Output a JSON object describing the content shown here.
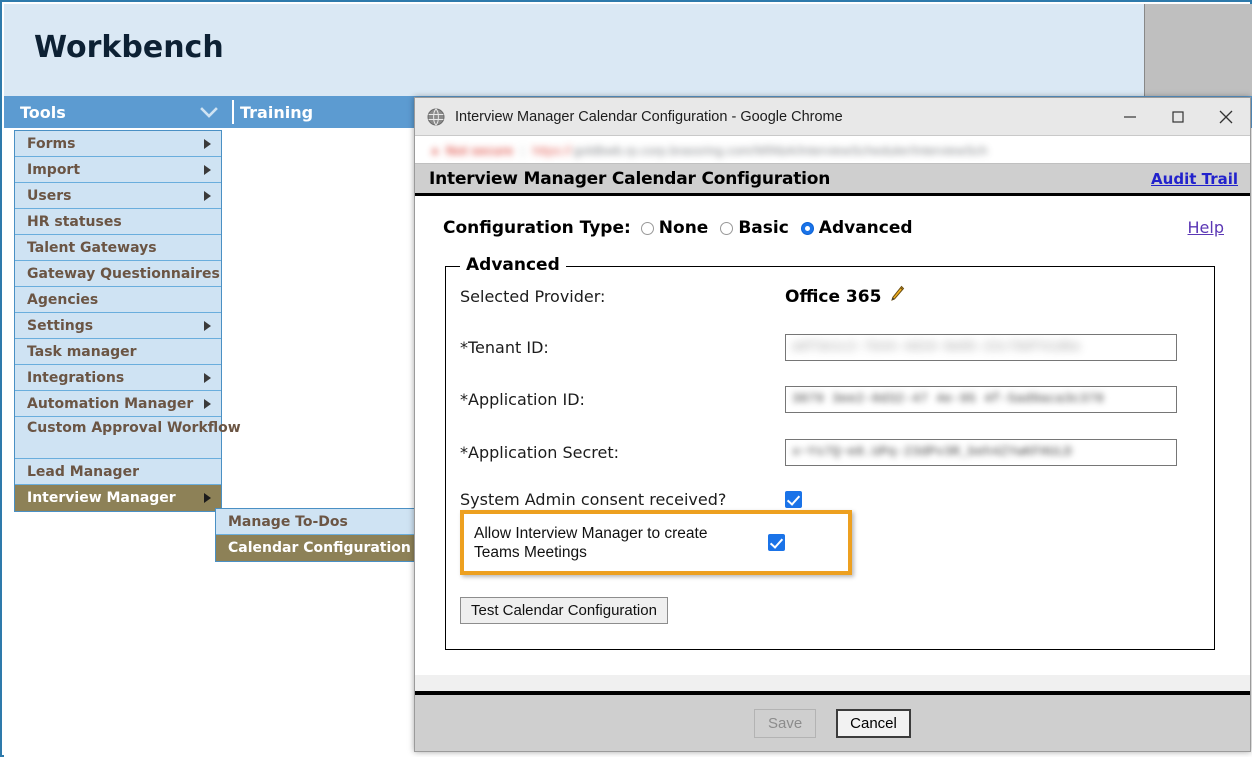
{
  "workbench": {
    "title": "Workbench",
    "menubar": {
      "tools_label": "Tools",
      "chevron_icon": "chevron-down-icon",
      "training_label": "Training"
    },
    "menu_items": [
      {
        "label": "Forms",
        "has_submenu": true
      },
      {
        "label": "Import",
        "has_submenu": true
      },
      {
        "label": "Users",
        "has_submenu": true
      },
      {
        "label": "HR statuses",
        "has_submenu": false
      },
      {
        "label": "Talent Gateways",
        "has_submenu": false
      },
      {
        "label": "Gateway Questionnaires",
        "has_submenu": false
      },
      {
        "label": "Agencies",
        "has_submenu": false
      },
      {
        "label": "Settings",
        "has_submenu": true
      },
      {
        "label": "Task manager",
        "has_submenu": false
      },
      {
        "label": "Integrations",
        "has_submenu": true
      },
      {
        "label": "Automation Manager",
        "has_submenu": true
      },
      {
        "label": "Custom Approval Workflow",
        "has_submenu": false
      },
      {
        "label": "Lead Manager",
        "has_submenu": false
      },
      {
        "label": "Interview Manager",
        "has_submenu": true,
        "active": true
      }
    ],
    "submenu_items": [
      {
        "label": "Manage To-Dos",
        "active": false
      },
      {
        "label": "Calendar Configuration",
        "active": true
      }
    ]
  },
  "browser": {
    "window_title": "Interview Manager Calendar Configuration - Google Chrome",
    "favicon_icon": "globe-icon",
    "minimize_icon": "minimize-icon",
    "maximize_icon": "maximize-icon",
    "close_icon": "close-icon",
    "url": {
      "lock_icon": "warning-icon",
      "security_label": "Not secure",
      "scheme": "https://",
      "rest": "goldbwb.rp.corp.brassring.com/WfAbA/InterviewScheduler/InterviewSch"
    }
  },
  "page": {
    "header_title": "Interview Manager Calendar Configuration",
    "audit_trail_label": "Audit Trail",
    "help_label": "Help",
    "config_type": {
      "label": "Configuration Type:",
      "options": [
        {
          "label": "None",
          "selected": false
        },
        {
          "label": "Basic",
          "selected": false
        },
        {
          "label": "Advanced",
          "selected": true
        }
      ]
    },
    "fieldset": {
      "legend": "Advanced",
      "provider_label": "Selected Provider:",
      "provider_value": "Office 365",
      "provider_edit_icon": "pencil-icon",
      "tenant_id_label": "*Tenant ID:",
      "tenant_id_value": "a6f3e1c2-7b44-4d19-9e05-22c7b8f41d6a",
      "application_id_label": "*Application ID:",
      "application_id_value": "3879 3ee2-0d32-47 4e-95 4f-5ad9aca3c378",
      "application_secret_label": "*Application Secret:",
      "application_secret_value": "x~Ys7Q~e8.UPq-23dPv3R_beh4ZYwKFHULD",
      "consent_label": "System Admin consent received?",
      "consent_checked": true,
      "teams_label": "Allow Interview Manager to create Teams Meetings",
      "teams_checked": true,
      "test_button_label": "Test Calendar Configuration"
    },
    "footer": {
      "save_label": "Save",
      "save_disabled": true,
      "cancel_label": "Cancel"
    }
  },
  "colors": {
    "accent_blue": "#5c9bd1",
    "header_blue": "#dae8f4",
    "menu_item_blue": "#cfe3f3",
    "menu_active_olive": "#8d8157",
    "highlight_orange": "#eda020",
    "checkbox_blue": "#1a73e8",
    "link_blue": "#2222cc",
    "help_purple": "#5b37b5"
  }
}
